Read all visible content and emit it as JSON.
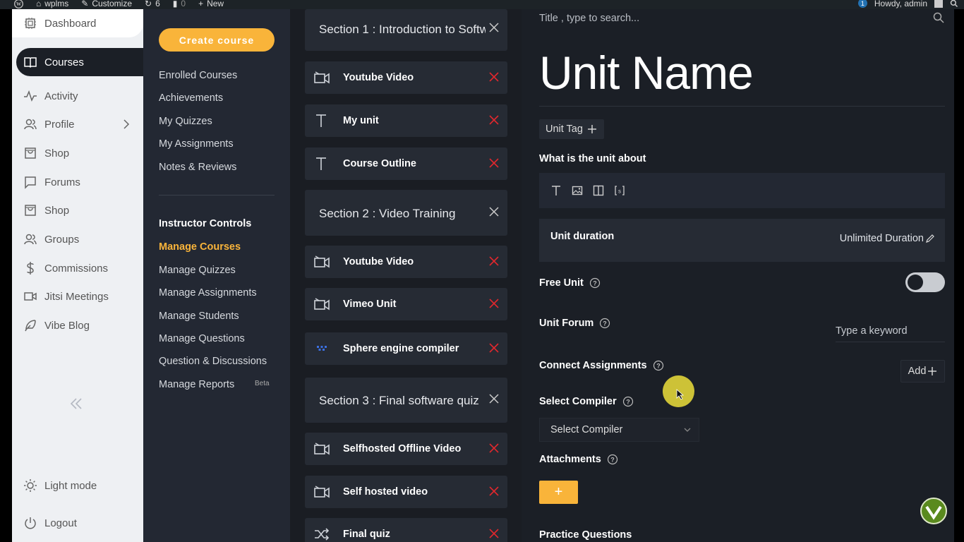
{
  "adminbar": {
    "site": "wplms",
    "customize": "Customize",
    "updates": "6",
    "comments": "0",
    "new": "New",
    "notifications": "1",
    "greeting": "Howdy, admin"
  },
  "leftnav": {
    "items": [
      {
        "label": "Dashboard",
        "icon": "dashboard-icon"
      },
      {
        "label": "Courses",
        "icon": "book-icon"
      },
      {
        "label": "Activity",
        "icon": "activity-icon"
      },
      {
        "label": "Profile",
        "icon": "users-icon"
      },
      {
        "label": "Shop",
        "icon": "bag-icon"
      },
      {
        "label": "Forums",
        "icon": "chat-icon"
      },
      {
        "label": "Shop",
        "icon": "bag-icon"
      },
      {
        "label": "Groups",
        "icon": "users-icon"
      },
      {
        "label": "Commissions",
        "icon": "dollar-icon"
      },
      {
        "label": "Jitsi Meetings",
        "icon": "video-icon"
      },
      {
        "label": "Vibe Blog",
        "icon": "feather-icon"
      }
    ],
    "light_mode": "Light mode",
    "logout": "Logout"
  },
  "subnav": {
    "create_course": "Create course",
    "links": [
      "Enrolled Courses",
      "Achievements",
      "My Quizzes",
      "My Assignments",
      "Notes & Reviews"
    ],
    "instructor_heading": "Instructor Controls",
    "instructor_links": [
      "Manage Courses",
      "Manage Quizzes",
      "Manage Assignments",
      "Manage Students",
      "Manage Questions",
      "Question & Discussions",
      "Manage Reports"
    ],
    "beta": "Beta"
  },
  "curriculum": {
    "sections": [
      "Section 1 : Introduction to Softw",
      "Section 2 : Video Training",
      "Section 3 : Final software quiz"
    ],
    "units": [
      {
        "title": "Youtube Video",
        "icon": "video-camera-icon"
      },
      {
        "title": "My unit",
        "icon": "text-icon"
      },
      {
        "title": "Course Outline",
        "icon": "text-icon"
      },
      {
        "title": "Youtube Video",
        "icon": "video-camera-icon"
      },
      {
        "title": "Vimeo Unit",
        "icon": "video-camera-icon"
      },
      {
        "title": "Sphere engine compiler",
        "icon": "compiler-icon"
      },
      {
        "title": "Selfhosted Offline Video",
        "icon": "video-camera-icon"
      },
      {
        "title": "Self hosted video",
        "icon": "video-camera-icon"
      },
      {
        "title": "Final quiz",
        "icon": "shuffle-icon"
      }
    ]
  },
  "editor": {
    "search_placeholder": "Title , type to search...",
    "unit_name": "Unit Name",
    "unit_tag": "Unit Tag",
    "about_label": "What is the unit about",
    "duration_label": "Unit duration",
    "duration_value": "Unlimited Duration",
    "free_unit": "Free Unit",
    "unit_forum": "Unit Forum",
    "forum_placeholder": "Type a keyword",
    "connect_assignments": "Connect Assignments",
    "add": "Add",
    "select_compiler_label": "Select Compiler",
    "select_compiler_value": "Select Compiler",
    "attachments": "Attachments",
    "attach_plus": "+",
    "practice_questions": "Practice Questions"
  },
  "colors": {
    "accent": "#f9b43a",
    "panel": "#262b34",
    "background": "#1b1f26",
    "delete": "#e0282d"
  }
}
